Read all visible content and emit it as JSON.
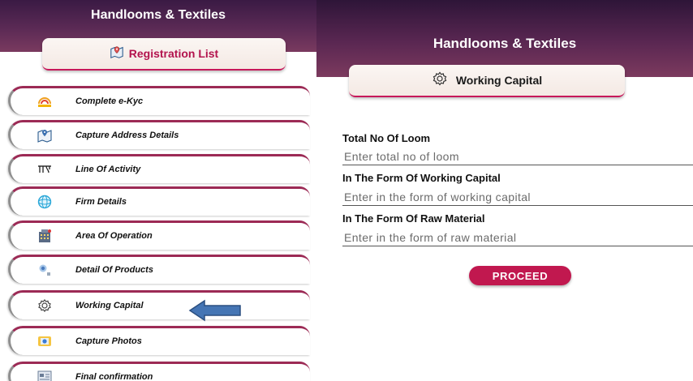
{
  "left_panel": {
    "app_title": "Handlooms & Textiles",
    "registration_list_label": "Registration List",
    "menu_items": [
      {
        "label": "Complete e-Kyc",
        "icon": "aadhaar-icon"
      },
      {
        "label": "Capture Address Details",
        "icon": "map-location-icon"
      },
      {
        "label": "Line Of Activity",
        "icon": "activity-text-icon"
      },
      {
        "label": "Firm Details",
        "icon": "firm-globe-icon"
      },
      {
        "label": "Area Of Operation",
        "icon": "building-icon"
      },
      {
        "label": "Detail Of Products",
        "icon": "products-icon"
      },
      {
        "label": "Working Capital",
        "icon": "gear-icon"
      },
      {
        "label": "Capture Photos",
        "icon": "camera-icon"
      },
      {
        "label": "Final confirmation",
        "icon": "confirmation-icon"
      }
    ],
    "highlight_arrow_target": "Working Capital"
  },
  "right_panel": {
    "app_title": "Handlooms & Textiles",
    "section_title": "Working Capital",
    "fields": [
      {
        "label": "Total No Of Loom",
        "placeholder": "Enter total no of loom",
        "value": ""
      },
      {
        "label": "In The Form Of Working Capital",
        "placeholder": "Enter in the form of working capital",
        "value": ""
      },
      {
        "label": "In The Form Of Raw Material",
        "placeholder": "Enter in the form of raw material",
        "value": ""
      }
    ],
    "proceed_label": "PROCEED"
  },
  "colors": {
    "header_dark": "#3a1a44",
    "accent": "#c1184f",
    "arrow": "#3f6ea8"
  }
}
